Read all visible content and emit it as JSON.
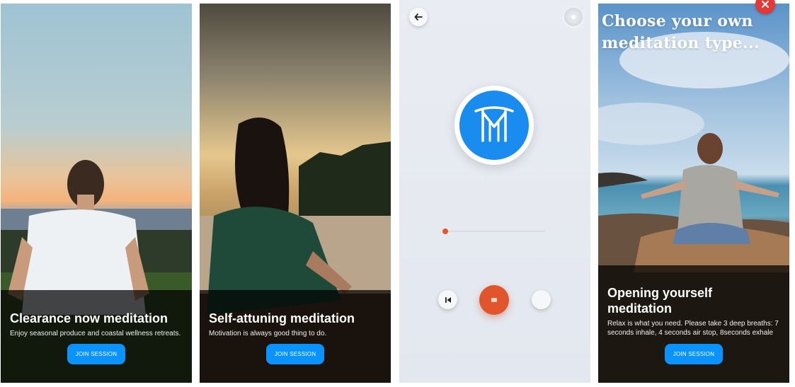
{
  "cards": [
    {
      "title": "Clearance now meditation",
      "description": "Enjoy seasonal produce and coastal wellness retreats.",
      "button_label": "JOIN SESSION"
    },
    {
      "title": "Self-attuning meditation",
      "description": "Motivation is always good thing to do.",
      "button_label": "JOIN SESSION"
    },
    {
      "title": "Opening yourself meditation",
      "description": "Relax is what you need. Please take 3 deep breaths: 7 seconds inhale, 4 seconds air stop, 8seconds exhale",
      "button_label": "JOIN SESSION"
    }
  ],
  "choose_screen": {
    "heading": "Choose your own meditation type..."
  },
  "player": {
    "progress": 0.02,
    "icons": {
      "back": "arrow-left-icon",
      "menu": "dot-icon",
      "logo": "meditation-m-logo",
      "previous": "skip-previous-icon",
      "stop": "stop-icon",
      "next": "next-icon",
      "close": "close-icon"
    }
  },
  "colors": {
    "accent_blue": "#0a93ff",
    "logo_blue": "#1a8cf0",
    "stop_orange": "#e1552c",
    "close_red": "#e53935"
  }
}
